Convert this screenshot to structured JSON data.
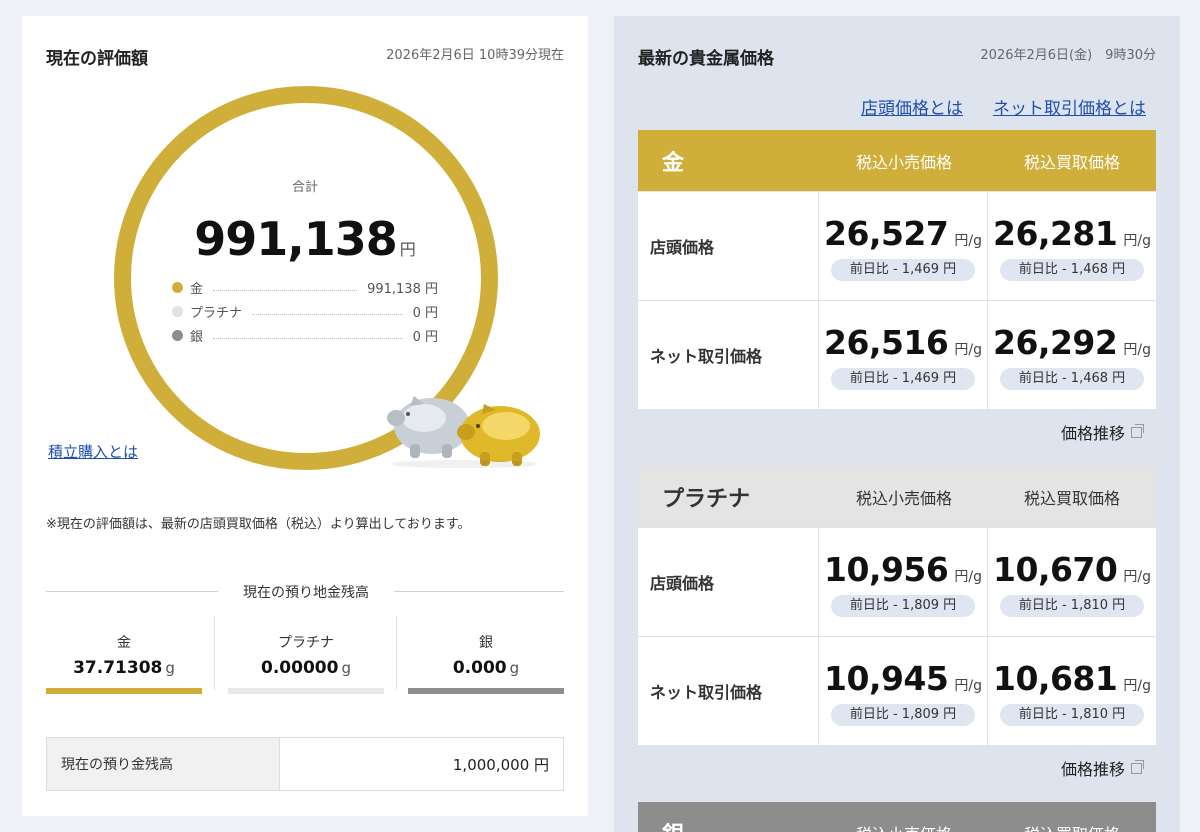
{
  "left": {
    "title": "現在の評価額",
    "timestamp": "2026年2月6日 10時39分現在",
    "donut": {
      "label": "合計",
      "total": "991,138",
      "unit": "円",
      "ring_color": "#d0ae3a",
      "legend": [
        {
          "name": "金",
          "value": "991,138 円",
          "color": "#d0ae3a"
        },
        {
          "name": "プラチナ",
          "value": "0 円",
          "color": "#e2e2e2"
        },
        {
          "name": "銀",
          "value": "0 円",
          "color": "#8d8d8d"
        }
      ]
    },
    "link_tsumitate": "積立購入とは",
    "note": "※現在の評価額は、最新の店頭買取価格（税込）より算出しております。",
    "balance_title": "現在の預り地金残高",
    "balances": [
      {
        "name": "金",
        "value": "37.71308",
        "unit": "g",
        "color": "#d0ae3a"
      },
      {
        "name": "プラチナ",
        "value": "0.00000",
        "unit": "g",
        "color": "#e8e8e8"
      },
      {
        "name": "銀",
        "value": "0.000",
        "unit": "g",
        "color": "#8d8d8d"
      }
    ],
    "cash": {
      "label": "現在の預り金残高",
      "value": "1,000,000 円"
    }
  },
  "right": {
    "title": "最新の貴金属価格",
    "timestamp": "2026年2月6日(金)　9時30分",
    "link_store": "店頭価格とは",
    "link_net": "ネット取引価格とは",
    "trend_label": "価格推移",
    "tables": [
      {
        "metal": "金",
        "header_color": "#d0ae3a",
        "header_text_color": "#ffffff",
        "cols": [
          "税込小売価格",
          "税込買取価格"
        ],
        "rows": [
          {
            "label": "店頭価格",
            "cells": [
              {
                "price": "26,527",
                "unit": "円/g",
                "change": "前日比 - 1,469 円"
              },
              {
                "price": "26,281",
                "unit": "円/g",
                "change": "前日比 - 1,468 円"
              }
            ]
          },
          {
            "label": "ネット取引価格",
            "cells": [
              {
                "price": "26,516",
                "unit": "円/g",
                "change": "前日比 - 1,469 円"
              },
              {
                "price": "26,292",
                "unit": "円/g",
                "change": "前日比 - 1,468 円"
              }
            ]
          }
        ]
      },
      {
        "metal": "プラチナ",
        "header_color": "#e4e4e4",
        "header_text_color": "#333333",
        "cols": [
          "税込小売価格",
          "税込買取価格"
        ],
        "rows": [
          {
            "label": "店頭価格",
            "cells": [
              {
                "price": "10,956",
                "unit": "円/g",
                "change": "前日比 - 1,809 円"
              },
              {
                "price": "10,670",
                "unit": "円/g",
                "change": "前日比 - 1,810 円"
              }
            ]
          },
          {
            "label": "ネット取引価格",
            "cells": [
              {
                "price": "10,945",
                "unit": "円/g",
                "change": "前日比 - 1,809 円"
              },
              {
                "price": "10,681",
                "unit": "円/g",
                "change": "前日比 - 1,810 円"
              }
            ]
          }
        ]
      },
      {
        "metal": "銀",
        "header_color": "#8d8d8d",
        "header_text_color": "#ffffff",
        "cols": [
          "税込小売価格",
          "税込買取価格"
        ]
      }
    ]
  }
}
